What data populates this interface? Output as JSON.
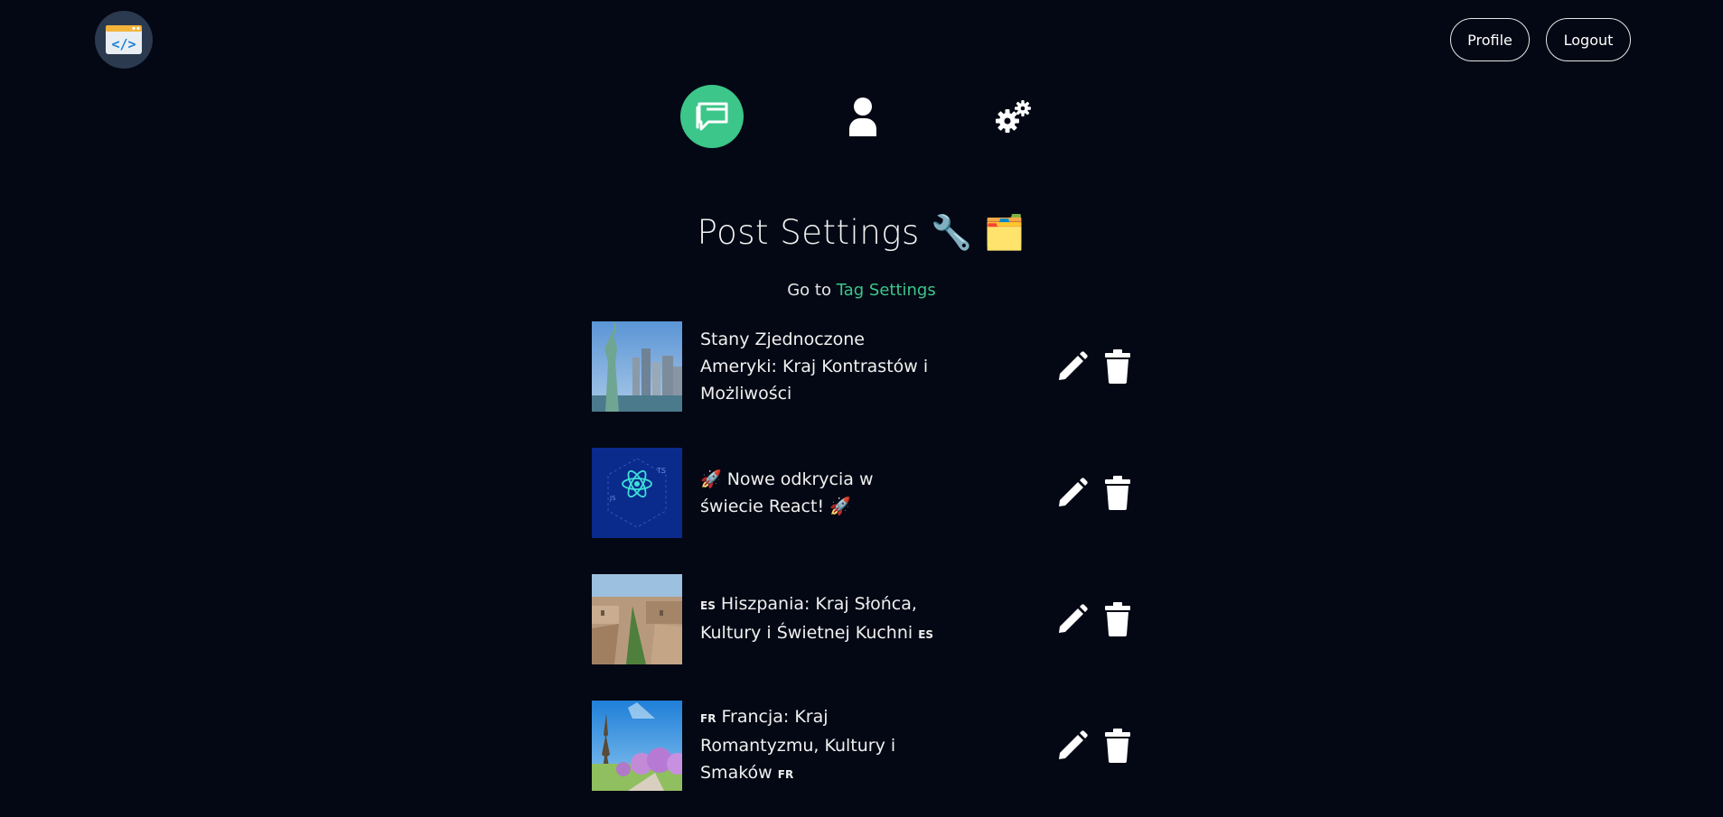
{
  "header": {
    "logo_icon": "code-window-icon",
    "profile_label": "Profile",
    "logout_label": "Logout"
  },
  "nav": {
    "items": [
      {
        "icon": "chat-post-icon",
        "active": true
      },
      {
        "icon": "user-icon",
        "active": false
      },
      {
        "icon": "gears-icon",
        "active": false
      }
    ],
    "accent": "#3cc68a"
  },
  "page": {
    "title": "Post Settings 🔧 🗂️",
    "goto_prefix": "Go to ",
    "goto_link": "Tag Settings"
  },
  "posts": [
    {
      "title": "Stany Zjednoczone Ameryki: Kraj Kontrastów i Możliwości",
      "thumb": "statue-of-liberty"
    },
    {
      "title": "🚀 Nowe odkrycia w świecie React! 🚀",
      "thumb": "react-logo"
    },
    {
      "title_flag1": "ES",
      "title_text": "Hiszpania: Kraj Słońca, Kultury i Świetnej Kuchni",
      "title_flag2": "ES",
      "thumb": "barcelona"
    },
    {
      "title_flag1": "FR",
      "title_text": "Francja: Kraj Romantyzmu, Kultury i Smaków",
      "title_flag2": "FR",
      "thumb": "eiffel-tower"
    }
  ],
  "colors": {
    "background": "#040814",
    "accent": "#3cc68a"
  }
}
